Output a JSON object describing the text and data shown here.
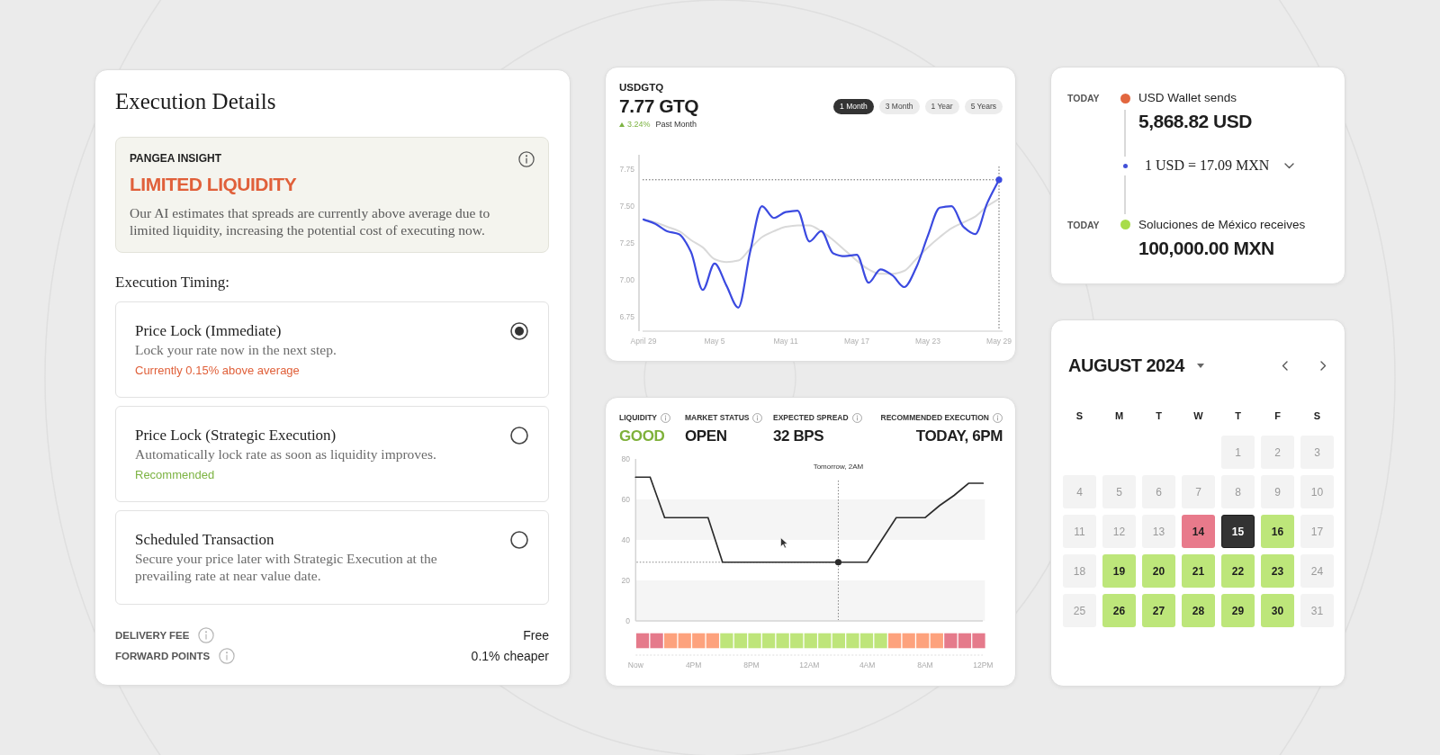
{
  "execution_details": {
    "title": "Execution Details",
    "insight": {
      "eyebrow": "PANGEA INSIGHT",
      "headline": "LIMITED LIQUIDITY",
      "body": "Our AI estimates that spreads are currently above average due to limited liquidity, increasing the potential cost of executing now."
    },
    "timing_heading": "Execution Timing:",
    "options": [
      {
        "title": "Price Lock (Immediate)",
        "description": "Lock your rate now in the next step.",
        "note": {
          "text": "Currently 0.15% above average",
          "kind": "warning"
        },
        "selected": true
      },
      {
        "title": "Price Lock (Strategic Execution)",
        "description": "Automatically lock rate as soon as liquidity improves.",
        "note": {
          "text": "Recommended",
          "kind": "positive"
        },
        "selected": false
      },
      {
        "title": "Scheduled Transaction",
        "description": "Secure your price later with Strategic Execution at the prevailing rate at near value date.",
        "selected": false
      }
    ],
    "fees": [
      {
        "label": "DELIVERY FEE",
        "value": "Free"
      },
      {
        "label": "FORWARD POINTS",
        "value": "0.1% cheaper"
      }
    ]
  },
  "rate_chart": {
    "pair": "USDGTQ",
    "rate": "7.77 GTQ",
    "change": {
      "value": "3.24%",
      "period": "Past Month"
    },
    "ranges": [
      {
        "label": "1 Month",
        "selected": true
      },
      {
        "label": "3 Month",
        "selected": false
      },
      {
        "label": "1 Year",
        "selected": false
      },
      {
        "label": "5 Years",
        "selected": false
      }
    ],
    "chart_data": {
      "type": "line",
      "categories": [
        "April 29",
        null,
        null,
        null,
        null,
        null,
        "May 5",
        null,
        null,
        null,
        null,
        null,
        "May 11",
        null,
        null,
        null,
        null,
        null,
        "May 17",
        null,
        null,
        null,
        null,
        null,
        "May 23",
        null,
        null,
        null,
        null,
        null,
        "May 29"
      ],
      "series": [
        {
          "color": "#3b4ae0",
          "values": [
            7.41,
            7.38,
            7.33,
            7.31,
            7.19,
            6.93,
            7.11,
            6.96,
            6.81,
            7.19,
            7.5,
            7.42,
            7.46,
            7.47,
            7.26,
            7.33,
            7.18,
            7.16,
            7.17,
            6.98,
            7.07,
            7.03,
            6.95,
            7.08,
            7.3,
            7.49,
            7.5,
            7.36,
            7.31,
            7.52,
            7.68
          ]
        },
        {
          "color": "#d9d9d9",
          "values": [
            7.41,
            7.39,
            7.36,
            7.33,
            7.27,
            7.22,
            7.14,
            7.12,
            7.13,
            7.21,
            7.29,
            7.33,
            7.36,
            7.37,
            7.37,
            7.33,
            7.27,
            7.2,
            7.13,
            7.07,
            7.04,
            7.04,
            7.06,
            7.14,
            7.22,
            7.29,
            7.35,
            7.39,
            7.43,
            7.5,
            7.55
          ]
        }
      ],
      "ylim": [
        6.65,
        7.85
      ],
      "yticks": [
        {
          "value": 6.75,
          "label": "6.75"
        },
        {
          "value": 7,
          "label": "7.00"
        },
        {
          "value": 7.25,
          "label": "7.25"
        },
        {
          "value": 7.5,
          "label": "7.50"
        },
        {
          "value": 7.75,
          "label": "7.75"
        }
      ],
      "ref_lines": [
        {
          "axis": "x",
          "value": "May 29"
        },
        {
          "axis": "y",
          "value": 7.68
        }
      ]
    }
  },
  "liquidity_forecast": {
    "stats": [
      {
        "label": "LIQUIDITY",
        "value": "GOOD",
        "color": "#7fb13a"
      },
      {
        "label": "MARKET STATUS",
        "value": "OPEN",
        "color": "#1e1e1e"
      },
      {
        "label": "EXPECTED SPREAD",
        "value": "32 BPS",
        "color": "#1e1e1e"
      },
      {
        "label": "RECOMMENDED EXECUTION",
        "value": "TODAY, 6PM",
        "color": "#1e1e1e"
      }
    ],
    "hover_label": "Tomorrow, 2AM",
    "chart_data": {
      "type": "line",
      "categories": [
        "Now",
        null,
        null,
        null,
        "4PM",
        null,
        null,
        null,
        "8PM",
        null,
        null,
        null,
        "12AM",
        null,
        null,
        null,
        "4AM",
        null,
        null,
        null,
        "8AM",
        null,
        null,
        null,
        "12PM"
      ],
      "series": [
        {
          "color": "#2b2b2b",
          "values": [
            71,
            71,
            51,
            51,
            51,
            51,
            29,
            29,
            29,
            29,
            29,
            29,
            29,
            29,
            29,
            29,
            29,
            40,
            51,
            51,
            51,
            57,
            62,
            68,
            68
          ]
        }
      ],
      "ylim": [
        0,
        80
      ],
      "yticks": [
        0,
        20,
        40,
        60,
        80
      ],
      "ref_lines": [
        {
          "axis": "y",
          "value": 29
        }
      ]
    },
    "hourly_liquidity": [
      {
        "color": "#e57a8b"
      },
      {
        "color": "#e57a8b"
      },
      {
        "color": "#fda27d"
      },
      {
        "color": "#fda27d"
      },
      {
        "color": "#fda27d"
      },
      {
        "color": "#fda27d"
      },
      {
        "color": "#bee57a"
      },
      {
        "color": "#bee57a"
      },
      {
        "color": "#bee57a"
      },
      {
        "color": "#bee57a"
      },
      {
        "color": "#bee57a"
      },
      {
        "color": "#bee57a"
      },
      {
        "color": "#bee57a"
      },
      {
        "color": "#bee57a"
      },
      {
        "color": "#bee57a"
      },
      {
        "color": "#bee57a"
      },
      {
        "color": "#bee57a"
      },
      {
        "color": "#bee57a"
      },
      {
        "color": "#fda27d"
      },
      {
        "color": "#fda27d"
      },
      {
        "color": "#fda27d"
      },
      {
        "color": "#fda27d"
      },
      {
        "color": "#e57a8b"
      },
      {
        "color": "#e57a8b"
      },
      {
        "color": "#e57a8b"
      }
    ]
  },
  "transfer": {
    "steps": [
      {
        "kind": "party",
        "when": "TODAY",
        "color": "#e2673f",
        "label": "USD Wallet sends",
        "amount": "5,868.82 USD"
      },
      {
        "kind": "rate",
        "color": "#4150d8",
        "label": "1 USD = 17.09 MXN",
        "expanded": false
      },
      {
        "kind": "party",
        "when": "TODAY",
        "color": "#a8dc4a",
        "label": "Soluciones de México receives",
        "amount": "100,000.00 MXN"
      }
    ]
  },
  "calendar": {
    "month": "AUGUST 2024",
    "weekdays": [
      "S",
      "M",
      "T",
      "W",
      "T",
      "F",
      "S"
    ],
    "weeks": [
      [
        {
          "label": "1",
          "kind": "off",
          "selected": false
        },
        {
          "label": "2",
          "kind": "off",
          "selected": false
        },
        {
          "label": "3",
          "kind": "off",
          "selected": false
        }
      ],
      [
        {
          "label": "4",
          "kind": "off",
          "selected": false
        },
        {
          "label": "5",
          "kind": "off",
          "selected": false
        },
        {
          "label": "6",
          "kind": "off",
          "selected": false
        },
        {
          "label": "7",
          "kind": "off",
          "selected": false
        },
        {
          "label": "8",
          "kind": "off",
          "selected": false
        },
        {
          "label": "9",
          "kind": "off",
          "selected": false
        },
        {
          "label": "10",
          "kind": "off",
          "selected": false
        }
      ],
      [
        {
          "label": "11",
          "kind": "off",
          "selected": false
        },
        {
          "label": "12",
          "kind": "off",
          "selected": false
        },
        {
          "label": "13",
          "kind": "off",
          "selected": false
        },
        {
          "label": "14",
          "kind": "poor",
          "selected": false
        },
        {
          "label": "15",
          "kind": "good",
          "selected": true
        },
        {
          "label": "16",
          "kind": "good",
          "selected": false
        },
        {
          "label": "17",
          "kind": "off",
          "selected": false
        }
      ],
      [
        {
          "label": "18",
          "kind": "off",
          "selected": false
        },
        {
          "label": "19",
          "kind": "good",
          "selected": false
        },
        {
          "label": "20",
          "kind": "good",
          "selected": false
        },
        {
          "label": "21",
          "kind": "good",
          "selected": false
        },
        {
          "label": "22",
          "kind": "good",
          "selected": false
        },
        {
          "label": "23",
          "kind": "good",
          "selected": false
        },
        {
          "label": "24",
          "kind": "off",
          "selected": false
        }
      ],
      [
        {
          "label": "25",
          "kind": "off",
          "selected": false
        },
        {
          "label": "26",
          "kind": "good",
          "selected": false
        },
        {
          "label": "27",
          "kind": "good",
          "selected": false
        },
        {
          "label": "28",
          "kind": "good",
          "selected": false
        },
        {
          "label": "29",
          "kind": "good",
          "selected": false
        },
        {
          "label": "30",
          "kind": "good",
          "selected": false
        },
        {
          "label": "31",
          "kind": "off",
          "selected": false
        }
      ]
    ]
  }
}
